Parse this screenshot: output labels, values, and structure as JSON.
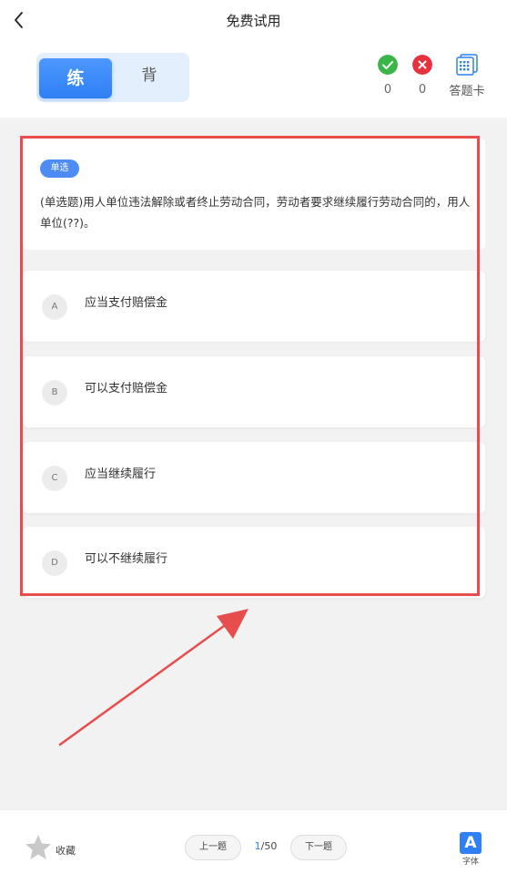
{
  "nav": {
    "title": "免费试用"
  },
  "mode": {
    "practice": "练",
    "recite": "背"
  },
  "stats": {
    "correct": "0",
    "wrong": "0",
    "answer_card": "答题卡"
  },
  "question": {
    "tag": "单选",
    "text": "(单选题)用人单位违法解除或者终止劳动合同，劳动者要求继续履行劳动合同的，用人单位(??)。",
    "options": [
      {
        "letter": "A",
        "text": "应当支付赔偿金"
      },
      {
        "letter": "B",
        "text": "可以支付赔偿金"
      },
      {
        "letter": "C",
        "text": "应当继续履行"
      },
      {
        "letter": "D",
        "text": "可以不继续履行"
      }
    ]
  },
  "bottom": {
    "favorite": "收藏",
    "prev": "上一题",
    "current": "1",
    "total": "/50",
    "next": "下一题",
    "font_glyph": "A",
    "font_label": "字体"
  },
  "colors": {
    "accent": "#2f80f5",
    "annotation": "#e84d4d",
    "correct": "#3ab549",
    "wrong": "#e8313f"
  }
}
